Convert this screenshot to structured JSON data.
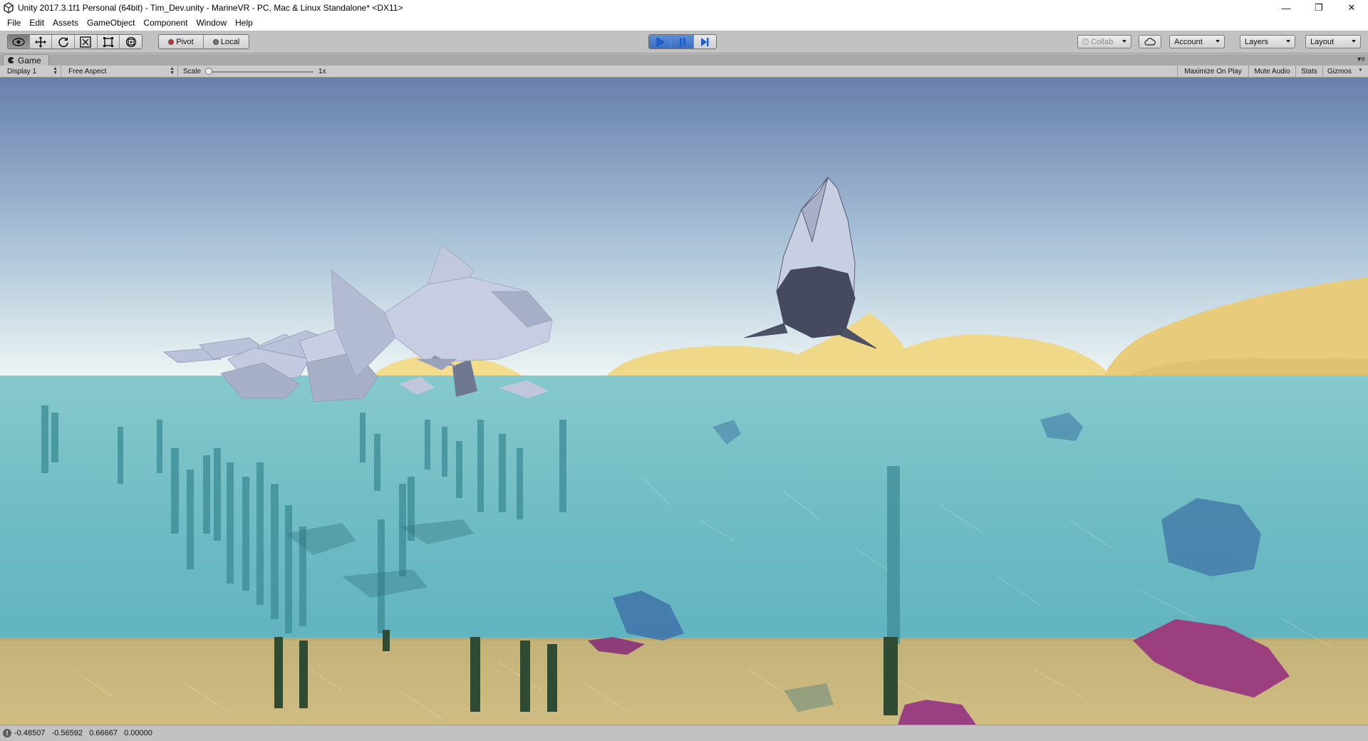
{
  "window": {
    "title": "Unity 2017.3.1f1 Personal (64bit) - Tim_Dev.unity - MarineVR - PC, Mac & Linux Standalone* <DX11>",
    "minimize_glyph": "—",
    "restore_glyph": "❐",
    "close_glyph": "✕"
  },
  "menu": {
    "items": [
      "File",
      "Edit",
      "Assets",
      "GameObject",
      "Component",
      "Window",
      "Help"
    ]
  },
  "toolbar": {
    "transform_tools": [
      {
        "name": "view-tool-icon",
        "active": true
      },
      {
        "name": "move-tool-icon",
        "active": false
      },
      {
        "name": "rotate-tool-icon",
        "active": false
      },
      {
        "name": "scale-tool-icon",
        "active": false
      },
      {
        "name": "rect-tool-icon",
        "active": false
      },
      {
        "name": "transform-tool-icon",
        "active": false
      }
    ],
    "pivot_label": "Pivot",
    "local_label": "Local",
    "play_state": {
      "playing": true,
      "paused": true
    },
    "collab_label": "Collab",
    "account_label": "Account",
    "layers_label": "Layers",
    "layout_label": "Layout",
    "accent_color": "#3a78d8"
  },
  "game_view": {
    "tab_label": "Game",
    "panel_menu_glyph": "▾≡",
    "display_label": "Display 1",
    "aspect_label": "Free Aspect",
    "scale_label": "Scale",
    "scale_value": "1x",
    "maximize_label": "Maximize On Play",
    "mute_label": "Mute Audio",
    "stats_label": "Stats",
    "gizmos_label": "Gizmos"
  },
  "scene": {
    "sky_top": "#6a82ad",
    "sky_horizon": "#eaf2f4",
    "water_color": "#7fc3c8",
    "sand_color": "#c9b779",
    "island_color": "#f0d98a"
  },
  "status": {
    "log_text": "-0.48507   -0.56592   0.66667   0.00000"
  }
}
